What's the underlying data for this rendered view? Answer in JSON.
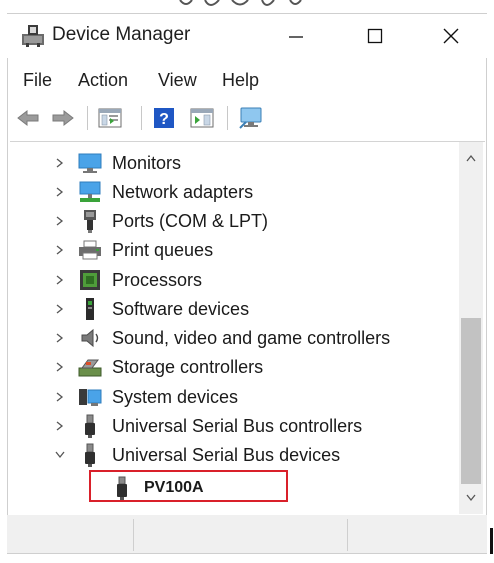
{
  "window": {
    "title": "Device Manager",
    "app_icon": "device-manager-icon"
  },
  "controls": {
    "minimize": "minimize-icon",
    "maximize": "maximize-icon",
    "close": "close-icon"
  },
  "menu": {
    "items": [
      {
        "label": "File"
      },
      {
        "label": "Action"
      },
      {
        "label": "View"
      },
      {
        "label": "Help"
      }
    ]
  },
  "toolbar": {
    "buttons": [
      "back-arrow-icon",
      "forward-arrow-icon",
      "properties-icon",
      "help-icon",
      "console-tree-icon",
      "monitor-icon"
    ]
  },
  "tree": {
    "items": [
      {
        "label": "Monitors",
        "icon": "monitor-icon",
        "state": "collapsed"
      },
      {
        "label": "Network adapters",
        "icon": "network-adapter-icon",
        "state": "collapsed"
      },
      {
        "label": "Ports (COM & LPT)",
        "icon": "port-icon",
        "state": "collapsed"
      },
      {
        "label": "Print queues",
        "icon": "printer-icon",
        "state": "collapsed"
      },
      {
        "label": "Processors",
        "icon": "processor-icon",
        "state": "collapsed"
      },
      {
        "label": "Software devices",
        "icon": "software-device-icon",
        "state": "collapsed"
      },
      {
        "label": "Sound, video and game controllers",
        "icon": "speaker-icon",
        "state": "collapsed"
      },
      {
        "label": "Storage controllers",
        "icon": "storage-controller-icon",
        "state": "collapsed"
      },
      {
        "label": "System devices",
        "icon": "system-device-icon",
        "state": "collapsed"
      },
      {
        "label": "Universal Serial Bus controllers",
        "icon": "usb-icon",
        "state": "collapsed"
      },
      {
        "label": "Universal Serial Bus devices",
        "icon": "usb-icon",
        "state": "expanded"
      }
    ],
    "child": {
      "label": "PV100A",
      "icon": "usb-device-icon",
      "highlight_color": "#d9202a"
    }
  },
  "colors": {
    "highlight": "#d9202a",
    "accent_blue": "#1e78d7"
  }
}
